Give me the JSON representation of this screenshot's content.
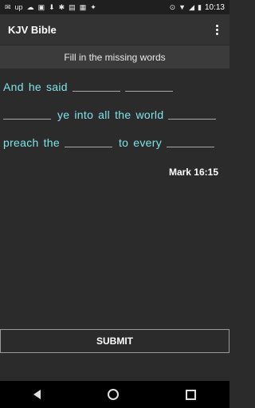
{
  "status_bar": {
    "time": "10:13",
    "left_icons": [
      "mail-icon",
      "up-icon",
      "cloud-icon",
      "flag-icon",
      "download-icon",
      "bug-icon",
      "bag-icon",
      "gallery-icon",
      "fitness-icon"
    ],
    "right_icons": [
      "location-icon",
      "wifi-icon",
      "signal-icon",
      "battery-icon"
    ]
  },
  "app_bar": {
    "title": "KJV Bible",
    "menu_icon": "overflow-menu-icon"
  },
  "instruction": "Fill in the missing words",
  "verse": {
    "line1": {
      "w1": "And",
      "w2": "he",
      "w3": "said"
    },
    "line2": {
      "w1": "ye",
      "w2": "into",
      "w3": "all",
      "w4": "the",
      "w5": "world"
    },
    "line3": {
      "w1": "preach",
      "w2": "the",
      "w3": "to",
      "w4": "every"
    },
    "reference": "Mark 16:15"
  },
  "submit_label": "SUBMIT",
  "nav_bar": {
    "icons": [
      "back-icon",
      "home-icon",
      "recents-icon"
    ]
  },
  "colors": {
    "word": "#7fe3e8",
    "background": "#2b2b2b",
    "app_bar": "#333333"
  }
}
